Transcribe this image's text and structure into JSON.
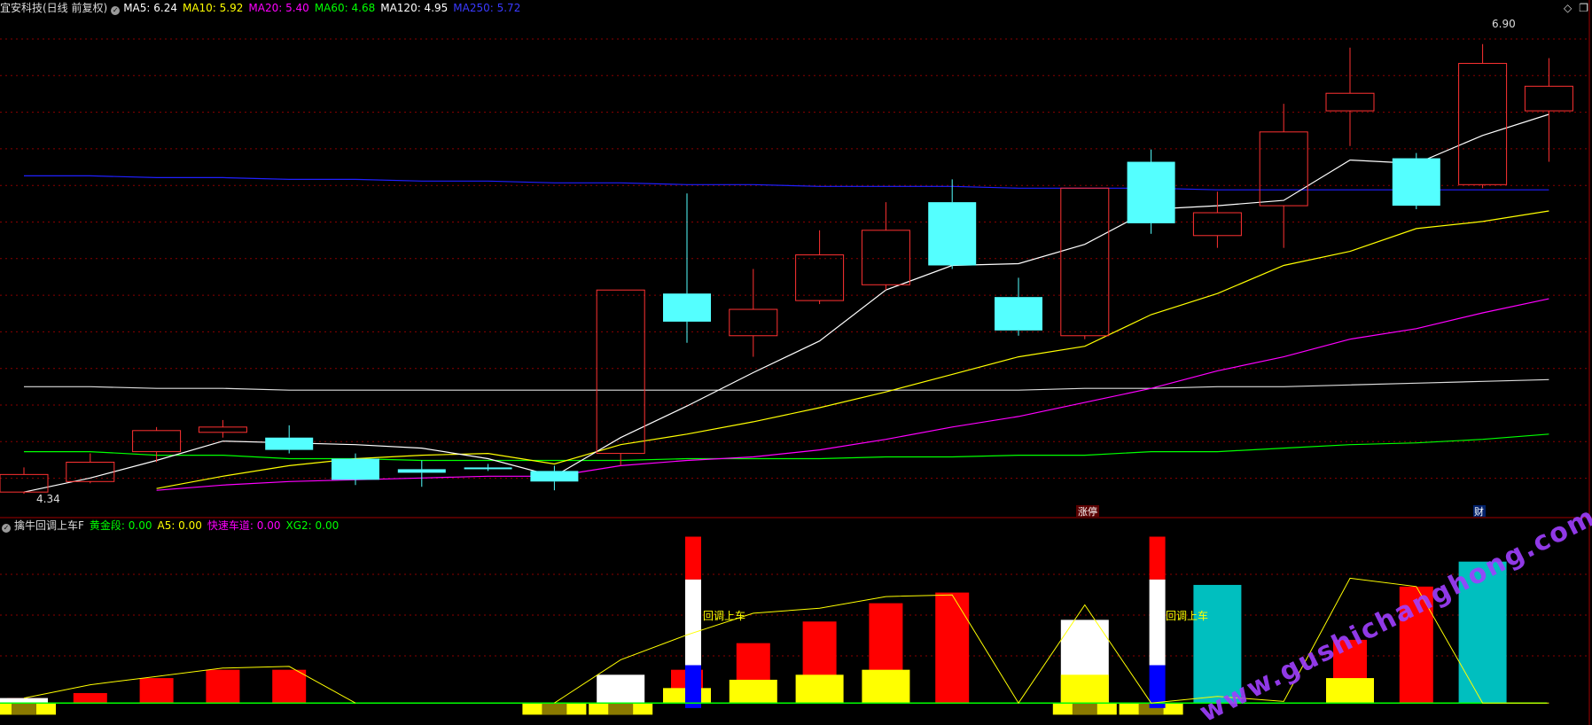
{
  "header": {
    "stock": "宜安科技(日线 前复权)",
    "ma_items": [
      {
        "label": "MA5: 6.24",
        "color": "#ffffff"
      },
      {
        "label": "MA10: 5.92",
        "color": "#ffff00"
      },
      {
        "label": "MA20: 5.40",
        "color": "#ff00ff"
      },
      {
        "label": "MA60: 4.68",
        "color": "#00ff00"
      },
      {
        "label": "MA120: 4.95",
        "color": "#ffffff"
      },
      {
        "label": "MA250: 5.72",
        "color": "#3a3aff"
      }
    ]
  },
  "sub_header": {
    "indicator": "擒牛回调上车F",
    "items": [
      {
        "label": "黄金段: 0.00",
        "color": "#00ff00"
      },
      {
        "label": "A5: 0.00",
        "color": "#ffff00"
      },
      {
        "label": "快速车道: 0.00",
        "color": "#ff00ff"
      },
      {
        "label": "XG2: 0.00",
        "color": "#00ff00"
      }
    ]
  },
  "annotations": {
    "high_label": "6.90",
    "low_label": "4.34",
    "limit_up_label": "涨停",
    "fin_label": "财",
    "pullback_label": "回调上车",
    "watermark": "www.gushichanghong.com"
  },
  "colors": {
    "up": "#ff3232",
    "down": "#54ffff",
    "grid": "#8a0000",
    "ma5": "#ffffff",
    "ma10": "#ffff00",
    "ma20": "#ff00ff",
    "ma60": "#00ff00",
    "ma120": "#dcdcdc",
    "ma250": "#2020ff",
    "watermark": "#a040ff"
  },
  "chart_data": [
    {
      "type": "candlestick",
      "title": "宜安科技(日线 前复权)",
      "ylim": [
        4.25,
        7.05
      ],
      "candles": [
        {
          "o": 4.35,
          "c": 4.45,
          "h": 4.49,
          "l": 4.34
        },
        {
          "o": 4.41,
          "c": 4.52,
          "h": 4.57,
          "l": 4.4
        },
        {
          "o": 4.58,
          "c": 4.7,
          "h": 4.72,
          "l": 4.52
        },
        {
          "o": 4.69,
          "c": 4.72,
          "h": 4.76,
          "l": 4.66
        },
        {
          "o": 4.66,
          "c": 4.59,
          "h": 4.73,
          "l": 4.57
        },
        {
          "o": 4.54,
          "c": 4.42,
          "h": 4.57,
          "l": 4.39
        },
        {
          "o": 4.48,
          "c": 4.46,
          "h": 4.53,
          "l": 4.38
        },
        {
          "o": 4.49,
          "c": 4.48,
          "h": 4.51,
          "l": 4.47
        },
        {
          "o": 4.47,
          "c": 4.41,
          "h": 4.5,
          "l": 4.36
        },
        {
          "o": 4.57,
          "c": 5.5,
          "h": 5.5,
          "l": 4.5
        },
        {
          "o": 5.48,
          "c": 5.32,
          "h": 6.05,
          "l": 5.2
        },
        {
          "o": 5.24,
          "c": 5.39,
          "h": 5.62,
          "l": 5.12
        },
        {
          "o": 5.44,
          "c": 5.7,
          "h": 5.84,
          "l": 5.42
        },
        {
          "o": 5.53,
          "c": 5.84,
          "h": 6.0,
          "l": 5.5
        },
        {
          "o": 6.0,
          "c": 5.64,
          "h": 6.13,
          "l": 5.62
        },
        {
          "o": 5.46,
          "c": 5.27,
          "h": 5.57,
          "l": 5.24
        },
        {
          "o": 5.24,
          "c": 6.08,
          "h": 6.08,
          "l": 5.22
        },
        {
          "o": 6.23,
          "c": 5.88,
          "h": 6.3,
          "l": 5.82
        },
        {
          "o": 5.81,
          "c": 5.94,
          "h": 6.06,
          "l": 5.74
        },
        {
          "o": 5.98,
          "c": 6.4,
          "h": 6.56,
          "l": 5.74
        },
        {
          "o": 6.52,
          "c": 6.62,
          "h": 6.88,
          "l": 6.32
        },
        {
          "o": 6.25,
          "c": 5.98,
          "h": 6.28,
          "l": 5.96
        },
        {
          "o": 6.1,
          "c": 6.79,
          "h": 6.9,
          "l": 6.08
        },
        {
          "o": 6.52,
          "c": 6.66,
          "h": 6.82,
          "l": 6.23
        }
      ],
      "ma5": [
        4.35,
        4.43,
        4.53,
        4.64,
        4.63,
        4.62,
        4.6,
        4.54,
        4.44,
        4.66,
        4.84,
        5.03,
        5.21,
        5.5,
        5.64,
        5.65,
        5.76,
        5.96,
        5.98,
        6.01,
        6.24,
        6.22,
        6.38,
        6.5
      ],
      "ma10": [
        null,
        null,
        4.37,
        4.44,
        4.5,
        4.54,
        4.56,
        4.57,
        4.51,
        4.62,
        4.68,
        4.75,
        4.83,
        4.92,
        5.02,
        5.12,
        5.18,
        5.36,
        5.48,
        5.64,
        5.72,
        5.85,
        5.89,
        5.95
      ],
      "ma20": [
        null,
        null,
        4.36,
        4.39,
        4.41,
        4.42,
        4.43,
        4.44,
        4.44,
        4.5,
        4.53,
        4.55,
        4.59,
        4.65,
        4.72,
        4.78,
        4.86,
        4.94,
        5.04,
        5.12,
        5.22,
        5.28,
        5.37,
        5.45
      ],
      "ma60": [
        4.58,
        4.58,
        4.56,
        4.56,
        4.54,
        4.54,
        4.53,
        4.53,
        4.53,
        4.53,
        4.54,
        4.54,
        4.54,
        4.55,
        4.55,
        4.56,
        4.56,
        4.58,
        4.58,
        4.6,
        4.62,
        4.63,
        4.65,
        4.68
      ],
      "ma120": [
        4.95,
        4.95,
        4.94,
        4.94,
        4.93,
        4.93,
        4.93,
        4.93,
        4.93,
        4.93,
        4.93,
        4.93,
        4.93,
        4.93,
        4.93,
        4.93,
        4.94,
        4.94,
        4.95,
        4.95,
        4.96,
        4.97,
        4.98,
        4.99
      ],
      "ma250": [
        6.15,
        6.15,
        6.14,
        6.14,
        6.13,
        6.13,
        6.12,
        6.12,
        6.11,
        6.11,
        6.1,
        6.1,
        6.09,
        6.09,
        6.09,
        6.08,
        6.08,
        6.08,
        6.07,
        6.07,
        6.07,
        6.07,
        6.07,
        6.07
      ]
    },
    {
      "type": "bar",
      "title": "擒牛回调上车F",
      "ylim": [
        -0.5,
        5.2
      ],
      "red_bars": [
        0.15,
        0.3,
        0.75,
        1.0,
        1.0,
        0,
        0,
        0,
        0,
        0,
        1.0,
        1.8,
        2.45,
        3.0,
        3.32,
        0,
        0,
        0,
        0,
        0,
        1.9,
        3.5,
        0,
        0
      ],
      "yellow_bars": [
        0,
        0,
        0,
        0,
        0,
        0,
        0,
        0,
        0,
        0,
        0.45,
        0.7,
        0.85,
        1.0,
        0,
        0,
        0.85,
        0,
        0,
        0,
        0.75,
        0,
        0,
        0
      ],
      "white_bars": [
        0.15,
        0,
        0,
        0,
        0,
        0,
        0,
        0,
        0,
        0.85,
        0,
        0,
        0,
        0,
        0,
        0,
        2.5,
        0,
        0,
        0,
        0,
        0,
        0,
        0
      ],
      "teal_bars": [
        0,
        0,
        0,
        0,
        0,
        0,
        0,
        0,
        0,
        0,
        0,
        0,
        0,
        0,
        0,
        0,
        0,
        0,
        3.55,
        0,
        0,
        0,
        4.25,
        0
      ],
      "bottom_bars": [
        0.35,
        0,
        0,
        0,
        0,
        0,
        0,
        0,
        0.35,
        0.35,
        0,
        0,
        0,
        0,
        0,
        0,
        0.35,
        0.35,
        0,
        0,
        0,
        0,
        0,
        0
      ],
      "line": [
        0.15,
        0.55,
        0.8,
        1.05,
        1.1,
        0,
        null,
        null,
        0,
        1.3,
        2.05,
        2.7,
        2.85,
        3.2,
        3.25,
        0,
        2.95,
        0,
        0.2,
        0.05,
        3.75,
        3.5,
        0,
        0
      ],
      "signals": [
        {
          "index": 10,
          "value": 5.0
        },
        {
          "index": 17,
          "value": 5.0
        }
      ]
    }
  ]
}
